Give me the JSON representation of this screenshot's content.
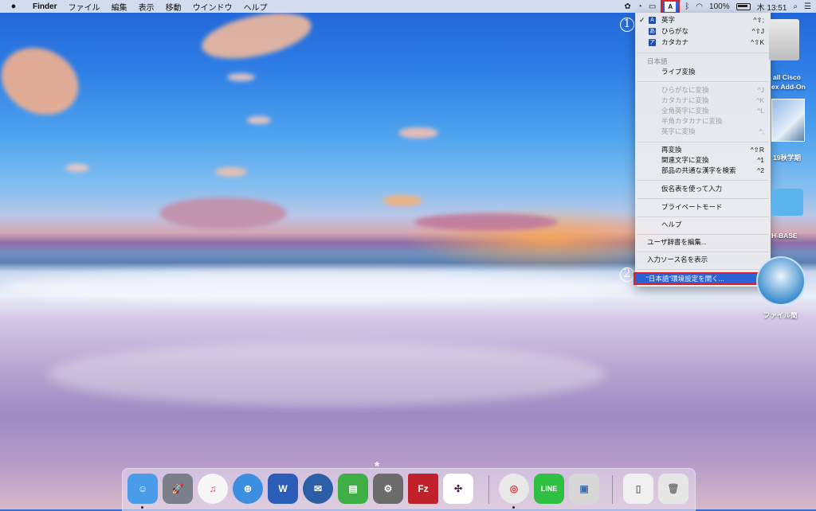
{
  "menubar": {
    "apple": "",
    "app": "Finder",
    "items": [
      "ファイル",
      "編集",
      "表示",
      "移動",
      "ウインドウ",
      "ヘルプ"
    ],
    "input_icon": "A",
    "battery": "100%",
    "clock": "木 13:51"
  },
  "input_menu": {
    "sources": [
      {
        "check": "✓",
        "badge": "A",
        "label": "英字",
        "shortcut": "^⇧;"
      },
      {
        "check": "",
        "badge": "あ",
        "label": "ひらがな",
        "shortcut": "^⇧J"
      },
      {
        "check": "",
        "badge": "ア",
        "label": "カタカナ",
        "shortcut": "^⇧K"
      }
    ],
    "section_header": "日本語",
    "live_convert": "ライブ変換",
    "disabled_items": [
      {
        "label": "ひらがなに変換",
        "shortcut": "^J"
      },
      {
        "label": "カタカナに変換",
        "shortcut": "^K"
      },
      {
        "label": "全角英字に変換",
        "shortcut": "^L"
      },
      {
        "label": "半角カタカナに変換",
        "shortcut": ""
      },
      {
        "label": "英字に変換",
        "shortcut": "^;"
      }
    ],
    "reconvert_items": [
      {
        "label": "再変換",
        "shortcut": "^⇧R"
      },
      {
        "label": "関連文字に変換",
        "shortcut": "^1"
      },
      {
        "label": "部品の共通な漢字を検索",
        "shortcut": "^2"
      }
    ],
    "kana_table": "仮名表を使って入力",
    "private_mode": "プライベートモード",
    "help": "ヘルプ",
    "edit_dictionary": "ユーザ辞書を編集...",
    "show_source_name": "入力ソース名を表示",
    "open_prefs": "“日本語”環境設定を開く..."
  },
  "annotations": {
    "step1": "1",
    "step2": "2"
  },
  "desktop_items": [
    {
      "label": "all Cisco"
    },
    {
      "label": "ex Add-On"
    },
    {
      "label": "19秋学期"
    },
    {
      "label": "H-BASE"
    },
    {
      "label": "ファイル簡"
    }
  ],
  "dock": {
    "apps": [
      {
        "name": "Finder",
        "glyph": "☺",
        "color": "#4a9be8"
      },
      {
        "name": "Launchpad",
        "glyph": "🚀",
        "color": "#7a7f8a"
      },
      {
        "name": "iTunes",
        "glyph": "♫",
        "color": "#f6f6f6"
      },
      {
        "name": "Safari",
        "glyph": "⊕",
        "color": "#3c8fe0"
      },
      {
        "name": "Word",
        "glyph": "W",
        "color": "#2a5cb8"
      },
      {
        "name": "Thunderbird",
        "glyph": "✉",
        "color": "#2a5fa8"
      },
      {
        "name": "Evernote",
        "glyph": "▤",
        "color": "#3fae45"
      },
      {
        "name": "System Preferences",
        "glyph": "⚙",
        "color": "#6b6b6b"
      },
      {
        "name": "FileZilla",
        "glyph": "Fz",
        "color": "#c0212a"
      },
      {
        "name": "Slack",
        "glyph": "✣",
        "color": "#ffffff"
      },
      {
        "name": "Chrome",
        "glyph": "◎",
        "color": "#e9e9e9"
      },
      {
        "name": "LINE",
        "glyph": "LINE",
        "color": "#2fbf41"
      },
      {
        "name": "Preview",
        "glyph": "▣",
        "color": "#d7d7d7"
      },
      {
        "name": "Downloads",
        "glyph": "▯",
        "color": "#f0f0f0"
      },
      {
        "name": "Trash",
        "glyph": "🗑",
        "color": "#e6e6e6"
      }
    ],
    "colors": {
      "accent": "#2a62d8",
      "highlight": "#e02020"
    }
  }
}
